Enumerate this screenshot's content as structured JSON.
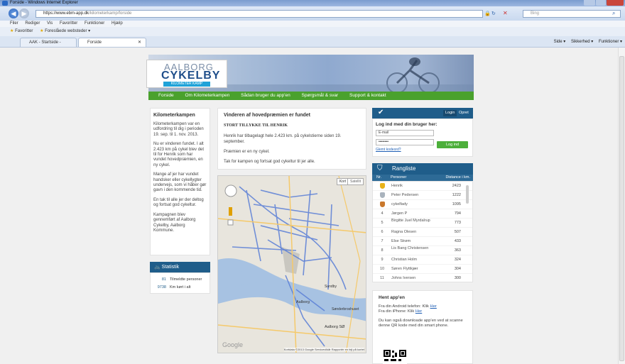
{
  "browser": {
    "window_title": "Forside - Windows Internet Explorer",
    "address": "https://www.ebm-app.dk/kilometerkamp/forside",
    "address_host": "https://www.ebm-app.dk",
    "address_path": "/kilometerkamp/forside",
    "search_placeholder": "Bing",
    "menu": [
      "Filer",
      "Rediger",
      "Vis",
      "Favoritter",
      "Funktioner",
      "Hjælp"
    ],
    "favorites_label": "Favoritter",
    "favorites_item": "Foreslåede websteder ▾",
    "tabs": [
      "AAK - Startside - Aalborg ...",
      "Forside"
    ],
    "commands": [
      "Side ▾",
      "Sikkerhed ▾",
      "Funktioner ▾"
    ]
  },
  "site": {
    "logo_line1": "AALBORG",
    "logo_line2": "CYKELBY",
    "logo_tag": "KILOMETER KAMP",
    "nav": [
      "Forside",
      "Om Kilometerkampen",
      "Sådan bruger du app'en",
      "Spørgsmål & svar",
      "Support & kontakt"
    ],
    "left": {
      "title": "Kilometerkampen",
      "paragraphs": [
        "Kilometerkampen var en udfordring til dig i perioden 19. sep. til 1. nov. 2013.",
        "Nu er vinderen fundet. I alt 2.423 km på cykel blev det til for Henrik som har vundet hovedpræmien, en ny cykel.",
        "Mange af jer har vundet handsker eller cykellygter undervejs, som vi håber gør gavn i den kommende tid.",
        "En tak til alle jer der deltog og fortsat god cykeltur.",
        "Kampagnen blev gennemført af Aalborg Cykelby, Aalborg Kommune."
      ],
      "stats_title": "Statistik",
      "stats": [
        {
          "n": "81",
          "label": "Tilmeldte personer"
        },
        {
          "n": "9738",
          "label": "Km kørt i alt"
        }
      ]
    },
    "center": {
      "title": "Vinderen af hovedpræmien er fundet",
      "subtitle": "STORT TILLYKKE TIL HENRIK",
      "p1": "Henrik har tilbagelagt hele 2.423 km. på cykelstierne siden 19. september.",
      "p2": "Præmien er en ny cykel.",
      "p3": "Tak for kampen og fortsat god cykeltur til jer alle."
    },
    "map": {
      "btn_map": "Kort",
      "btn_sat": "Satellit",
      "google": "Google",
      "footer": "Kortdata ©2013 Google   Servicevilkår   Rapportér en fejl på kortet",
      "labels": [
        "Aalborg",
        "Aalborg SØ",
        "Sønderbroshuset",
        "Sundby"
      ]
    },
    "login": {
      "tab_login": "Login",
      "tab_opret": "Opret",
      "title": "Log ind med din bruger her:",
      "email_placeholder": "E-mail",
      "password_value": "••••••••",
      "button": "Log ind",
      "forgot": "Glemt kodeord?"
    },
    "ranking": {
      "title": "Rangliste",
      "col_nr": "Nr.",
      "col_person": "Personer",
      "col_dist": "Distance i km.",
      "rows": [
        {
          "r": "1",
          "name": "Henrik",
          "d": "2423",
          "medal": "#e8b21a"
        },
        {
          "r": "2",
          "name": "Peter Pedersen",
          "d": "1222",
          "medal": "#a9b3bd"
        },
        {
          "r": "3",
          "name": "cykelfady",
          "d": "1095",
          "medal": "#c9782c"
        },
        {
          "r": "4",
          "name": "Jørgen P",
          "d": "794"
        },
        {
          "r": "5",
          "name": "Birgitte Juel Myrdalrup",
          "d": "773"
        },
        {
          "r": "6",
          "name": "Ragna Olesen",
          "d": "507"
        },
        {
          "r": "7",
          "name": "Else Strøm",
          "d": "433"
        },
        {
          "r": "8",
          "name": "Lis Bang Christensen",
          "d": "363"
        },
        {
          "r": "9",
          "name": "Christian Holm",
          "d": "324"
        },
        {
          "r": "10",
          "name": "Søren Flyttkjær",
          "d": "304"
        },
        {
          "r": "11",
          "name": "Johns Iversen",
          "d": "300"
        }
      ]
    },
    "app": {
      "title": "Hent app'en",
      "android_text": "Fra din Android telefon: Klik",
      "iphone_text": "Fra din iPhone: Klik",
      "link": "Her",
      "qr_text": "Du kan også downloade app'en ved at scanne denne QR kode med din smart phone."
    }
  },
  "colors": {
    "brand_blue": "#1f5d8a",
    "nav_green": "#4aa12d",
    "login_green": "#4caf3a"
  }
}
